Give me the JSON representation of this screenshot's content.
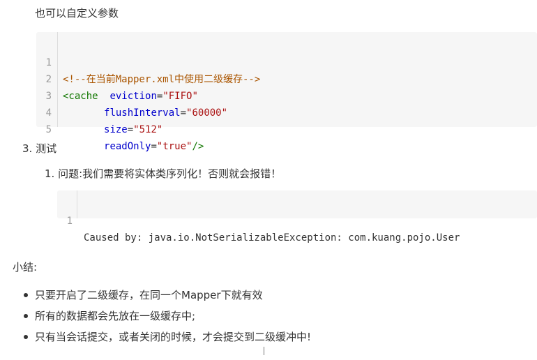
{
  "intro_text": "也可以自定义参数",
  "xml_code": {
    "line_numbers": [
      "1",
      "2",
      "3",
      "4",
      "5"
    ],
    "line1": {
      "comment": "<!--在当前Mapper.xml中使用二级缓存-->"
    },
    "line2": {
      "tag": "<cache",
      "spaces": "  ",
      "attr": "eviction",
      "eq": "=",
      "value": "\"FIFO\""
    },
    "line3": {
      "indent": "       ",
      "attr": "flushInterval",
      "eq": "=",
      "value": "\"60000\""
    },
    "line4": {
      "indent": "       ",
      "attr": "size",
      "eq": "=",
      "value": "\"512\""
    },
    "line5": {
      "indent": "       ",
      "attr": "readOnly",
      "eq": "=",
      "value": "\"true\"",
      "close": "/>"
    }
  },
  "section": {
    "heading": "3. 测试",
    "item1": "1. 问题:我们需要将实体类序列化！否则就会报错！"
  },
  "error_code": {
    "line_number": "1",
    "text": "Caused by: java.io.NotSerializableException: com.kuang.pojo.User"
  },
  "summary": {
    "title": "小结:",
    "bullets": [
      "只要开启了二级缓存，在同一个Mapper下就有效",
      "所有的数据都会先放在一级缓存中;",
      "只有当会话提交，或者关闭的时候，才会提交到二级缓冲中!"
    ]
  }
}
